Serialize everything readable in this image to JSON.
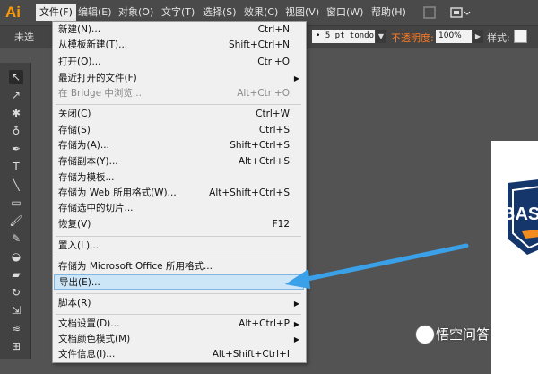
{
  "app": {
    "logo": "Ai"
  },
  "menubar": {
    "items": [
      {
        "name": "menu-file",
        "label": "文件(F)"
      },
      {
        "name": "menu-edit",
        "label": "编辑(E)"
      },
      {
        "name": "menu-object",
        "label": "对象(O)"
      },
      {
        "name": "menu-type",
        "label": "文字(T)"
      },
      {
        "name": "menu-select",
        "label": "选择(S)"
      },
      {
        "name": "menu-effect",
        "label": "效果(C)"
      },
      {
        "name": "menu-view",
        "label": "视图(V)"
      },
      {
        "name": "menu-window",
        "label": "窗口(W)"
      },
      {
        "name": "menu-help",
        "label": "帮助(H)"
      }
    ]
  },
  "control_bar": {
    "selection_label": "未选",
    "brush": "• 5 pt tondo",
    "opacity_label": "不透明度:",
    "opacity_value": "100%",
    "style_label": "样式:"
  },
  "file_menu": {
    "items": [
      {
        "label": "新建(N)...",
        "shortcut": "Ctrl+N"
      },
      {
        "label": "从模板新建(T)...",
        "shortcut": "Shift+Ctrl+N"
      },
      {
        "label": "打开(O)...",
        "shortcut": "Ctrl+O"
      },
      {
        "label": "最近打开的文件(F)",
        "shortcut": "",
        "submenu": true
      },
      {
        "label": "在 Bridge 中浏览...",
        "shortcut": "Alt+Ctrl+O",
        "disabled": true
      },
      {
        "label": "关闭(C)",
        "shortcut": "Ctrl+W"
      },
      {
        "label": "存储(S)",
        "shortcut": "Ctrl+S"
      },
      {
        "label": "存储为(A)...",
        "shortcut": "Shift+Ctrl+S"
      },
      {
        "label": "存储副本(Y)...",
        "shortcut": "Alt+Ctrl+S"
      },
      {
        "label": "存储为模板...",
        "shortcut": ""
      },
      {
        "label": "存储为 Web 所用格式(W)...",
        "shortcut": "Alt+Shift+Ctrl+S"
      },
      {
        "label": "存储选中的切片...",
        "shortcut": ""
      },
      {
        "label": "恢复(V)",
        "shortcut": "F12"
      },
      {
        "label": "置入(L)...",
        "shortcut": ""
      },
      {
        "label": "存储为 Microsoft Office 所用格式...",
        "shortcut": ""
      },
      {
        "label": "导出(E)...",
        "shortcut": "",
        "highlighted": true
      },
      {
        "label": "脚本(R)",
        "shortcut": "",
        "submenu": true
      },
      {
        "label": "文档设置(D)...",
        "shortcut": "Alt+Ctrl+P"
      },
      {
        "label": "文档颜色模式(M)",
        "shortcut": "",
        "submenu": true
      },
      {
        "label": "文件信息(I)...",
        "shortcut": "Alt+Shift+Ctrl+I"
      }
    ]
  },
  "canvas": {
    "logo_text": "BAS"
  },
  "watermark": {
    "text": "悟空问答"
  },
  "colors": {
    "accent": "#ff9a00",
    "highlight": "#cde6f7",
    "arrow": "#3aa0e8"
  }
}
